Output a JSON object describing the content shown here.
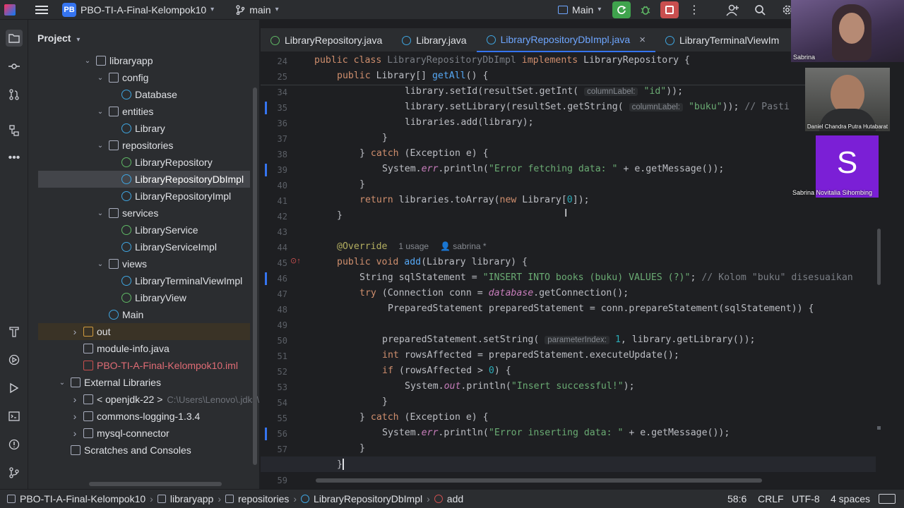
{
  "topbar": {
    "project_badge": "PB",
    "project_name": "PBO-TI-A-Final-Kelompok10",
    "branch": "main",
    "run_config": "Main"
  },
  "project_panel": {
    "title": "Project",
    "tree": [
      {
        "label": "libraryapp",
        "icon": "package-icon",
        "depth": 2,
        "chev": "open"
      },
      {
        "label": "config",
        "icon": "package-icon",
        "depth": 3,
        "chev": "open"
      },
      {
        "label": "Database",
        "icon": "class-icon",
        "depth": 4,
        "chev": "none"
      },
      {
        "label": "entities",
        "icon": "package-icon",
        "depth": 3,
        "chev": "open"
      },
      {
        "label": "Library",
        "icon": "class-icon",
        "depth": 4,
        "chev": "none"
      },
      {
        "label": "repositories",
        "icon": "package-icon",
        "depth": 3,
        "chev": "open"
      },
      {
        "label": "LibraryRepository",
        "icon": "interface-icon",
        "depth": 4,
        "chev": "none"
      },
      {
        "label": "LibraryRepositoryDbImpl",
        "icon": "class-icon",
        "depth": 4,
        "chev": "none",
        "selected": true
      },
      {
        "label": "LibraryRepositoryImpl",
        "icon": "class-icon",
        "depth": 4,
        "chev": "none"
      },
      {
        "label": "services",
        "icon": "package-icon",
        "depth": 3,
        "chev": "open"
      },
      {
        "label": "LibraryService",
        "icon": "interface-icon",
        "depth": 4,
        "chev": "none"
      },
      {
        "label": "LibraryServiceImpl",
        "icon": "class-icon",
        "depth": 4,
        "chev": "none"
      },
      {
        "label": "views",
        "icon": "package-icon",
        "depth": 3,
        "chev": "open"
      },
      {
        "label": "LibraryTerminalViewImpl",
        "icon": "class-icon",
        "depth": 4,
        "chev": "none"
      },
      {
        "label": "LibraryView",
        "icon": "interface-icon",
        "depth": 4,
        "chev": "none"
      },
      {
        "label": "Main",
        "icon": "main-class-icon",
        "depth": 3,
        "chev": "none"
      },
      {
        "label": "out",
        "icon": "folder-icon",
        "depth": 1,
        "chev": "closed",
        "outrow": true
      },
      {
        "label": "module-info.java",
        "icon": "file-icon",
        "depth": 1,
        "chev": "none"
      },
      {
        "label": "PBO-TI-A-Final-Kelompok10.iml",
        "icon": "iml-file-icon",
        "depth": 1,
        "chev": "none",
        "red": true
      },
      {
        "label": "External Libraries",
        "icon": "library-icon",
        "depth": 0,
        "chev": "open"
      },
      {
        "label": "< openjdk-22 >",
        "extra": "C:\\Users\\Lenovo\\.jdks\\op",
        "icon": "library-icon",
        "depth": 1,
        "chev": "closed"
      },
      {
        "label": "commons-logging-1.3.4",
        "icon": "library-icon",
        "depth": 1,
        "chev": "closed"
      },
      {
        "label": "mysql-connector",
        "icon": "library-icon",
        "depth": 1,
        "chev": "closed"
      },
      {
        "label": "Scratches and Consoles",
        "icon": "scratches-icon",
        "depth": 0,
        "chev": "none"
      }
    ]
  },
  "tabs": [
    {
      "label": "LibraryRepository.java",
      "kind": "interface"
    },
    {
      "label": "Library.java",
      "kind": "class"
    },
    {
      "label": "LibraryRepositoryDbImpl.java",
      "kind": "class",
      "active": true,
      "closable": true
    },
    {
      "label": "LibraryTerminalViewIm",
      "kind": "class"
    }
  ],
  "editor": {
    "sticky_1": "public class LibraryRepositoryDbImpl implements LibraryRepository {",
    "sticky_1_ln": "24",
    "sticky_2_ln": "25",
    "line_numbers": [
      "34",
      "35",
      "36",
      "37",
      "38",
      "39",
      "40",
      "41",
      "42",
      "43",
      "44",
      "45",
      "46",
      "47",
      "48",
      "49",
      "50",
      "51",
      "52",
      "53",
      "54",
      "55",
      "56",
      "57",
      "58"
    ],
    "hint_column_label": "columnLabel:",
    "hint_parameter_index": "parameterIndex:",
    "usages": "1 usage",
    "author": "sabrina *",
    "last_ln": "59"
  },
  "statusbar": {
    "crumbs": [
      "PBO-TI-A-Final-Kelompok10",
      "libraryapp",
      "repositories",
      "LibraryRepositoryDbImpl",
      "add"
    ],
    "position": "58:6",
    "line_ending": "CRLF",
    "encoding": "UTF-8",
    "indent": "4 spaces"
  },
  "video": {
    "participant_1": "Sabrina",
    "participant_2": "Daniel Chandra Putra Hutabarat",
    "participant_3": "Sabrina Novitalia Sihombing",
    "participant_3_initial": "S"
  },
  "colors": {
    "accent": "#3574f0",
    "background": "#1e1f22",
    "panel": "#2b2d30",
    "avatar_purple": "#7b1fd6"
  }
}
